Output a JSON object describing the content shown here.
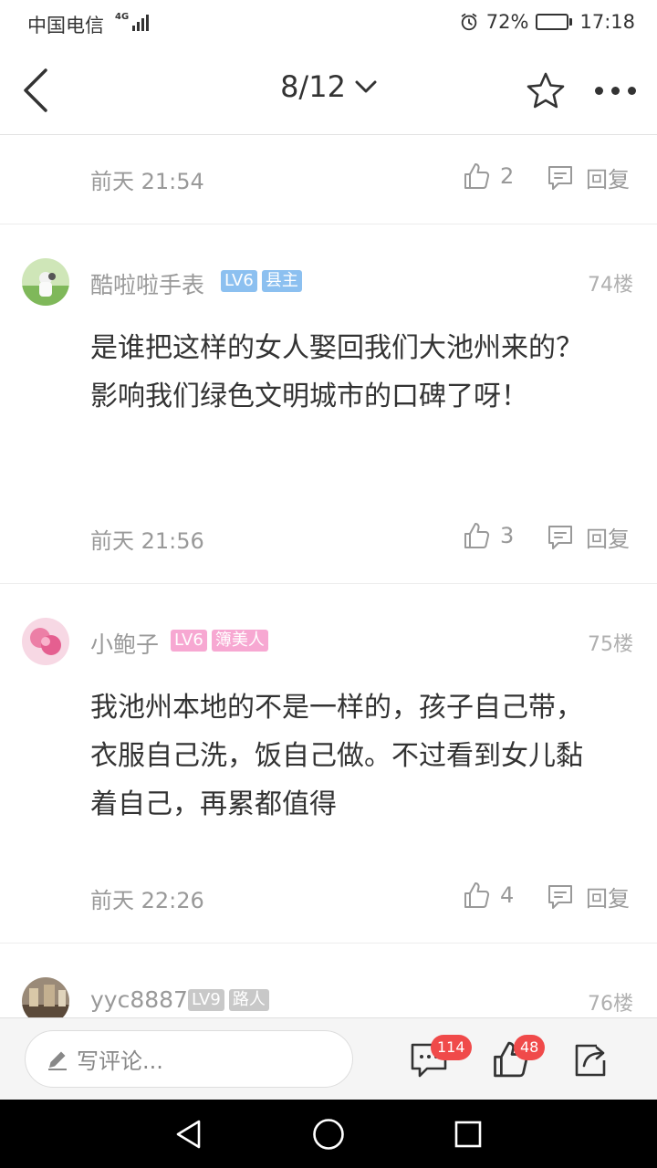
{
  "status_bar": {
    "carrier": "中国电信",
    "network": "4G",
    "battery": "72%",
    "battery_level": 0.72,
    "time": "17:18"
  },
  "nav": {
    "page_indicator": "8/12"
  },
  "prev_comment_meta": {
    "time": "前天 21:54",
    "likes": "2",
    "reply_label": "回复"
  },
  "comments": [
    {
      "username": "酷啦啦手表",
      "level": "LV6",
      "title": "县主",
      "floor": "74楼",
      "text": "是谁把这样的女人娶回我们大池州来的？影响我们绿色文明城市的口碑了呀！",
      "time": "前天 21:56",
      "likes": "3",
      "reply_label": "回复",
      "level_color": "#8cc0f0",
      "title_color": "#8cc0f0"
    },
    {
      "username": "小鲍子",
      "level": "LV6",
      "title": "簿美人",
      "floor": "75楼",
      "text": "我池州本地的不是一样的，孩子自己带，衣服自己洗，饭自己做。不过看到女儿黏着自己，再累都值得",
      "time": "前天 22:26",
      "likes": "4",
      "reply_label": "回复",
      "level_color": "#f7a8d2",
      "title_color": "#f7a8d2"
    },
    {
      "username": "yyc8887",
      "level": "LV9",
      "title": "路人",
      "floor": "76楼",
      "level_color": "#c8c8c8",
      "title_color": "#c8c8c8"
    }
  ],
  "bottom_bar": {
    "input_placeholder": "写评论...",
    "comment_count": "114",
    "like_count": "48"
  },
  "icons": {
    "back": "chevron-left-icon",
    "dropdown": "chevron-down-icon",
    "favorite": "star-icon",
    "more": "more-dots-icon",
    "like": "thumbs-up-icon",
    "reply": "reply-bubble-icon",
    "share": "share-icon"
  }
}
